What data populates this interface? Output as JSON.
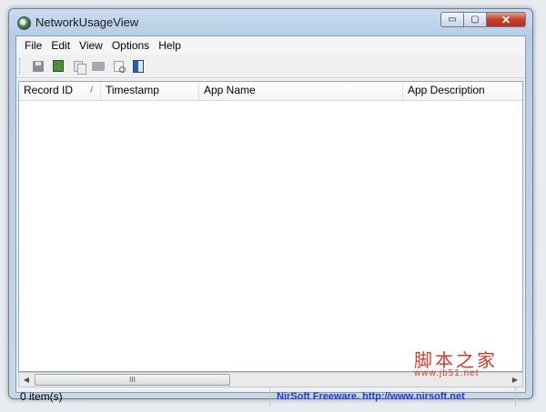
{
  "window": {
    "title": "NetworkUsageView",
    "buttons": {
      "minimize": "▭",
      "maximize": "▢",
      "close": "✕"
    }
  },
  "menu": [
    "File",
    "Edit",
    "View",
    "Options",
    "Help"
  ],
  "toolbar": {
    "icons": [
      "save-icon",
      "refresh-icon",
      "copy-icon",
      "properties-icon",
      "find-icon",
      "exit-icon"
    ]
  },
  "columns": [
    {
      "label": "Record ID",
      "sort": "/"
    },
    {
      "label": "Timestamp"
    },
    {
      "label": "App Name"
    },
    {
      "label": "App Description"
    }
  ],
  "scrollbar": {
    "left": "◀",
    "right": "▶",
    "thumb_grip": "III"
  },
  "status": {
    "count": "0 item(s)",
    "nirsoft": "NirSoft Freeware.  http://www.nirsoft.net"
  },
  "watermark": {
    "text": "脚本之家",
    "url": "www.jb51.net"
  },
  "colors": {
    "titlebar": "#b7cde6",
    "close": "#c4412b",
    "nirsoft_link": "#1d3ad6",
    "watermark": "#d23a2a"
  }
}
